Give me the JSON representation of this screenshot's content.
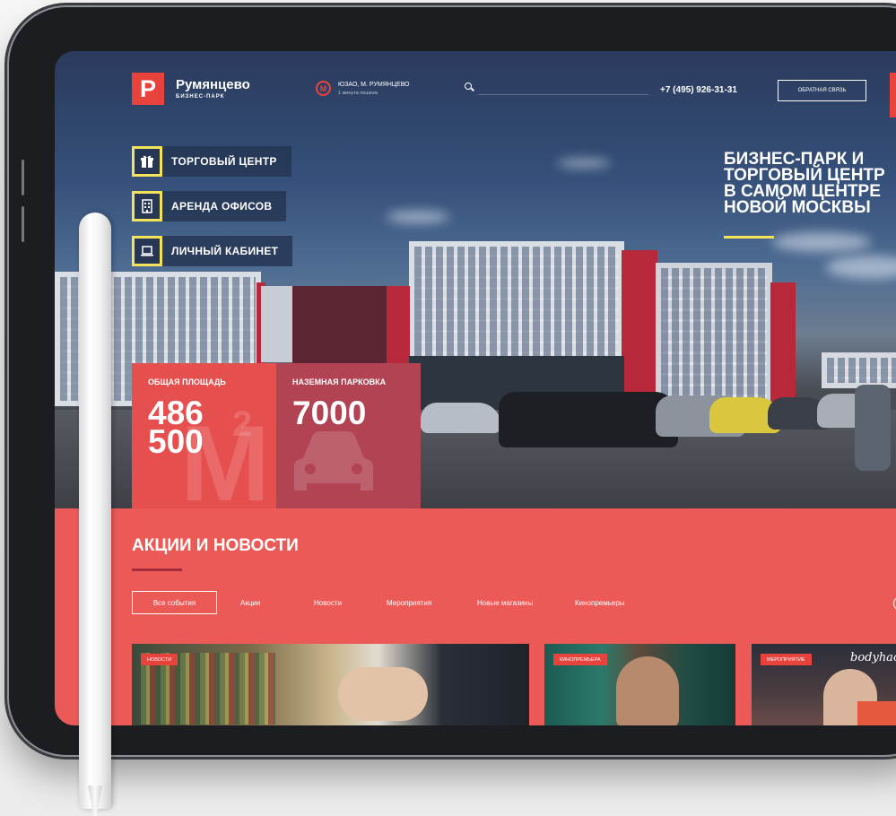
{
  "header": {
    "logo_letter": "P",
    "logo_name": "Румянцево",
    "logo_sub": "БИЗНЕС-ПАРК",
    "metro_icon": "М",
    "metro_title": "ЮЗАО, М. РУМЯНЦЕВО",
    "metro_sub": "1 минута пешком",
    "phone": "+7 (495) 926-31-31",
    "callback_label": "ОБРАТНАЯ СВЯЗЬ"
  },
  "menu": [
    {
      "label": "ТОРГОВЫЙ ЦЕНТР",
      "icon": "gift-icon"
    },
    {
      "label": "АРЕНДА ОФИСОВ",
      "icon": "building-icon"
    },
    {
      "label": "ЛИЧНЫЙ КАБИНЕТ",
      "icon": "laptop-icon"
    }
  ],
  "hero": {
    "headline": "БИЗНЕС-ПАРК И\nТОРГОВЫЙ ЦЕНТР\nВ САМОМ ЦЕНТРЕ\nНОВОЙ МОСКВЫ"
  },
  "stats": [
    {
      "label": "ОБЩАЯ ПЛОЩАДЬ",
      "value": "486\n500",
      "bg_text": "M",
      "bg_sup": "2"
    },
    {
      "label": "НАЗЕМНАЯ ПАРКОВКА",
      "value": "7000",
      "bg_icon": "car-icon"
    }
  ],
  "news": {
    "title": "АКЦИИ И НОВОСТИ",
    "filters": [
      "Все события",
      "Акции",
      "Новости",
      "Мероприятия",
      "Новые магазины",
      "Кинопремьеры"
    ],
    "active_filter": "Все события",
    "arrow": "‹",
    "cards": [
      {
        "tag": "НОВОСТИ"
      },
      {
        "tag": "КИНОПРЕМЬЕРА"
      },
      {
        "tag": "МЕРОПРИЯТИЕ",
        "brand": "bodyhack"
      }
    ]
  },
  "colors": {
    "accent": "#e8423d",
    "news_bg": "#ec5a57",
    "highlight": "#f2e35a",
    "dark_navy": "#263654"
  }
}
